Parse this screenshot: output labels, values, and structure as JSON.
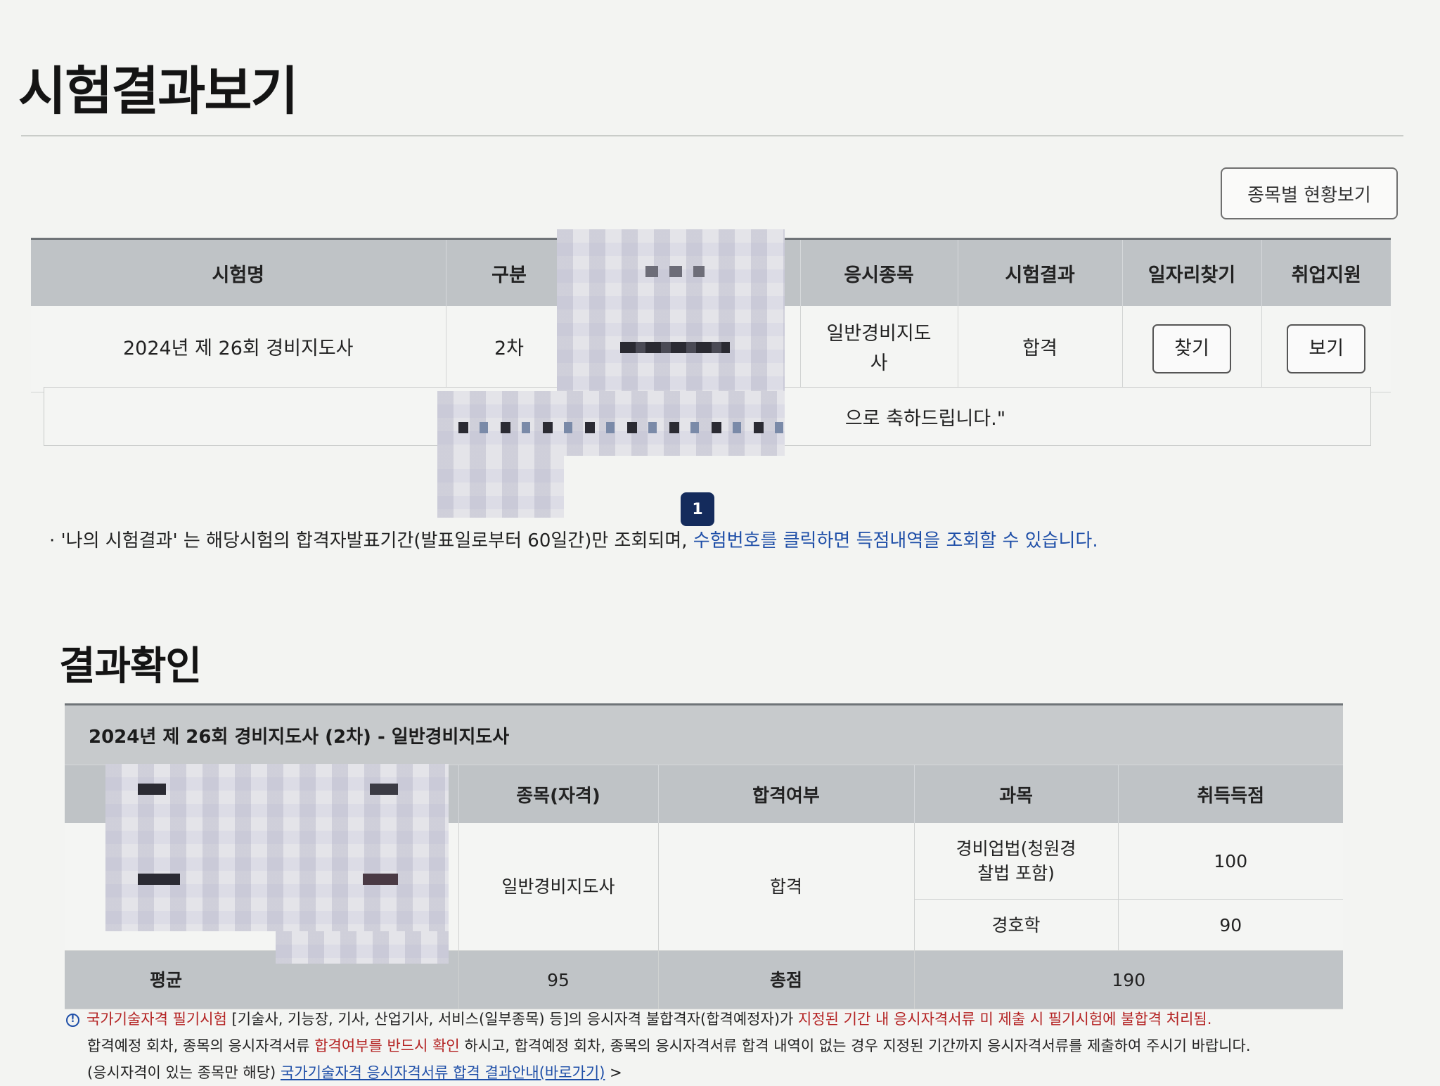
{
  "page": {
    "title": "시험결과보기"
  },
  "toolbar": {
    "status_button": "종목별 현황보기"
  },
  "results": {
    "headers": [
      "시험명",
      "구분",
      "",
      "응시종목",
      "시험결과",
      "일자리찾기",
      "취업지원"
    ],
    "row": {
      "exam_name": "2024년 제 26회 경비지도사",
      "round": "2차",
      "subject": "일반경비지도사",
      "result": "합격",
      "job_button": "찾기",
      "support_button": "보기"
    },
    "congrats_visible": "으로 축하드립니다.\""
  },
  "pagination": {
    "current": "1"
  },
  "notice": {
    "text": "· '나의 시험결과' 는 해당시험의 합격자발표기간(발표일로부터 60일간)만 조회되며,",
    "link": "수험번호를 클릭하면 득점내역을 조회할 수 있습니다."
  },
  "result_check": {
    "title": "결과확인",
    "exam_header": "2024년 제 26회 경비지도사 (2차) - 일반경비지도사",
    "headers": [
      "",
      "종목(자격)",
      "합격여부",
      "과목",
      "취득득점"
    ],
    "category": "일반경비지도사",
    "pass_status": "합격",
    "subjects": [
      {
        "name": "경비업법(청원경찰법 포함)",
        "score": "100"
      },
      {
        "name": "경호학",
        "score": "90"
      }
    ],
    "average_label": "평균",
    "average_value": "95",
    "total_label": "총점",
    "total_value": "190"
  },
  "warning": {
    "red1": "국가기술자격 필기시험",
    "text1": " [기술사, 기능장, 기사, 산업기사, 서비스(일부종목) 등]의 응시자격 불합격자(합격예정자)가 ",
    "red2": "지정된 기간 내 응시자격서류 미 제출 시 필기시험에 불합격 처리됨.",
    "text2a": "합격예정 회차, 종목의 응시자격서류 ",
    "red3": "합격여부를 반드시 확인",
    "text2b": " 하시고, 합격예정 회차, 종목의 응시자격서류 합격 내역이 없는 경우 지정된 기간까지 응시자격서류를 제출하여 주시기 바랍니다.",
    "text3": "(응시자격이 있는 종목만 해당) ",
    "link": "국가기술자격 응시자격서류 합격 결과안내(바로가기)",
    "chevron": ">"
  }
}
